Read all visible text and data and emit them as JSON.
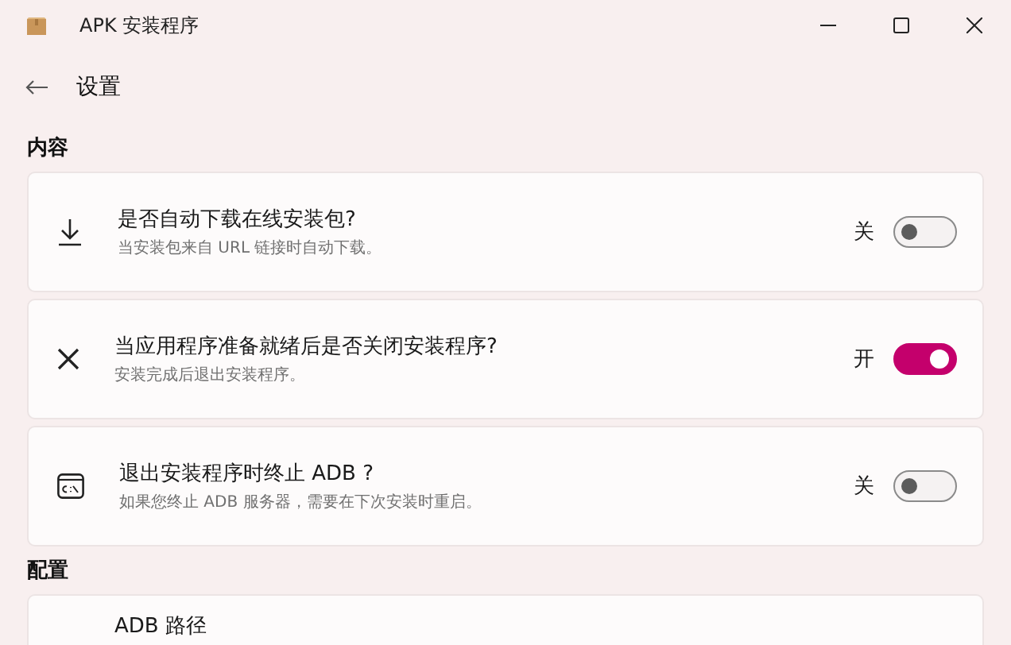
{
  "window": {
    "title": "APK 安装程序"
  },
  "header": {
    "title": "设置"
  },
  "sections": [
    {
      "title": "内容",
      "items": [
        {
          "kind": "toggle",
          "title": "是否自动下载在线安装包?",
          "description": "当安装包来自 URL 链接时自动下载。",
          "state_label": "关",
          "on": false
        },
        {
          "kind": "toggle",
          "title": "当应用程序准备就绪后是否关闭安装程序?",
          "description": "安装完成后退出安装程序。",
          "state_label": "开",
          "on": true
        },
        {
          "kind": "toggle",
          "title": "退出安装程序时终止 ADB ?",
          "description": "如果您终止 ADB 服务器，需要在下次安装时重启。",
          "state_label": "关",
          "on": false
        }
      ]
    },
    {
      "title": "配置",
      "items": [
        {
          "kind": "path",
          "title": "ADB 路径"
        }
      ]
    }
  ]
}
